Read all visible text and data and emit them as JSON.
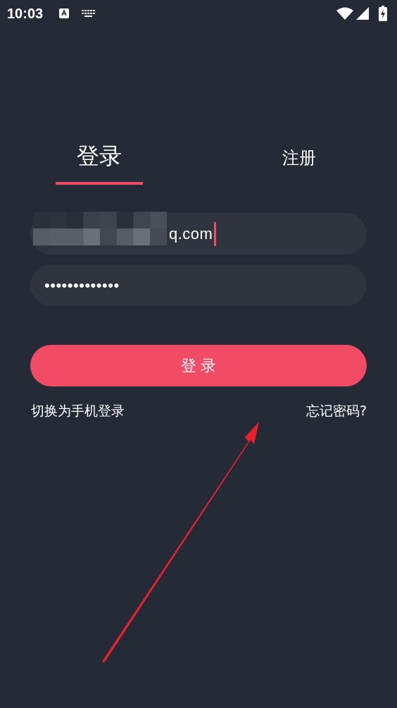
{
  "status_bar": {
    "time": "10:03"
  },
  "tabs": [
    {
      "label": "登录",
      "selected": true
    },
    {
      "label": "注册",
      "selected": false
    }
  ],
  "email_field": {
    "value": "q.com",
    "redacted": true,
    "focused": true
  },
  "password_field": {
    "value": "•••••••••••••"
  },
  "login_button": {
    "label": "登 录"
  },
  "links": {
    "switch": "切换为手机登录",
    "forgot": "忘记密码?"
  },
  "annotation": {
    "kind": "arrow"
  }
}
